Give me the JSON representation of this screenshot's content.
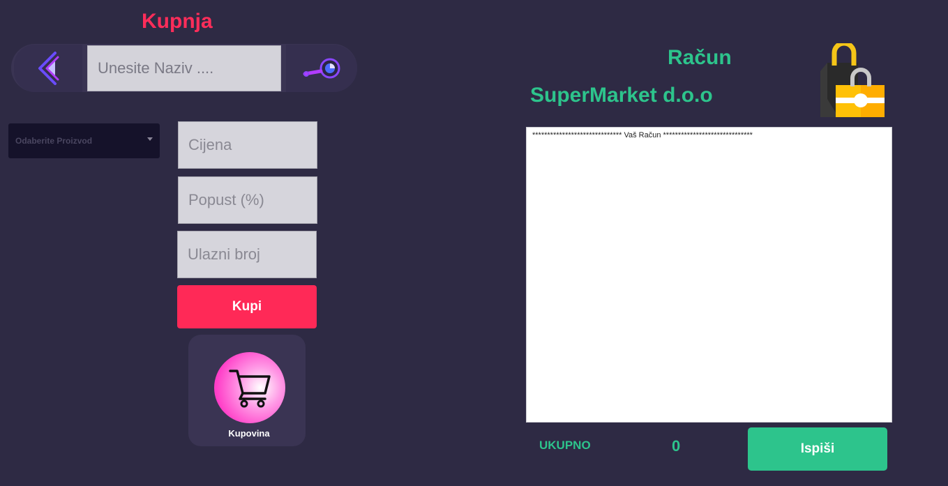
{
  "purchase": {
    "title": "Kupnja",
    "search_placeholder": "Unesite Naziv ....",
    "product_select": {
      "selected": "Odaberite Proizvod"
    },
    "price_placeholder": "Cijena",
    "discount_placeholder": "Popust (%)",
    "input_number_placeholder": "Ulazni broj",
    "buy_label": "Kupi",
    "shopping_label": "Kupovina"
  },
  "receipt": {
    "title": "Račun",
    "company": "SuperMarket d.o.o",
    "header_line": "****************************** Vaš Račun ******************************",
    "total_label": "UKUPNO",
    "total_value": "0",
    "print_label": "Ispiši"
  },
  "icons": {
    "back": "back-chevron-icon",
    "search": "magnifier-icon",
    "cart": "cart-icon",
    "bag": "shopping-bag-icon"
  },
  "colors": {
    "background": "#2e2a44",
    "accent_red": "#ff2957",
    "accent_green": "#2dc48c",
    "pink": "#ff3fc8"
  }
}
